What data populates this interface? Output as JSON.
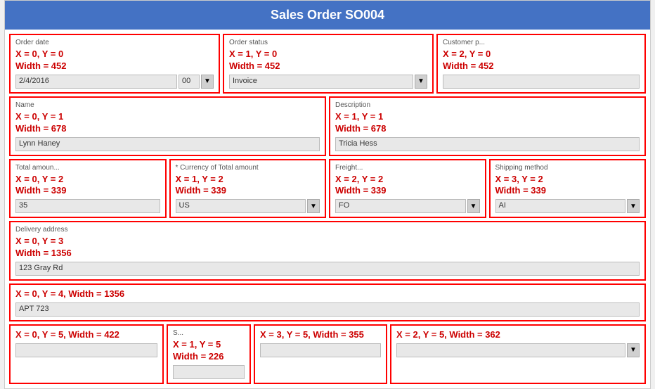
{
  "title": "Sales Order SO004",
  "rows": [
    {
      "id": "row0",
      "cells": [
        {
          "label": "Order date",
          "coord": "X = 0, Y = 0",
          "width": "Width = 452",
          "input_value": "2/4/2016",
          "input2_value": "00",
          "has_dropdown": true
        },
        {
          "label": "Order status",
          "coord": "X = 1, Y = 0",
          "width": "Width = 452",
          "input_value": "Invoice",
          "has_dropdown": true
        },
        {
          "label": "Customer p...",
          "coord": "X = 2, Y = 0",
          "width": "Width = 452",
          "input_value": "",
          "has_dropdown": false
        }
      ]
    },
    {
      "id": "row1",
      "cells": [
        {
          "label": "Name",
          "coord": "X = 0, Y = 1",
          "width": "Width = 678",
          "input_value": "Lynn Haney",
          "has_dropdown": false
        },
        {
          "label": "Description",
          "coord": "X = 1, Y = 1",
          "width": "Width = 678",
          "input_value": "Tricia Hess",
          "has_dropdown": false
        }
      ]
    },
    {
      "id": "row2",
      "cells": [
        {
          "label": "Total amoun...",
          "coord": "X = 0, Y = 2",
          "width": "Width = 339",
          "input_value": "35",
          "has_dropdown": false
        },
        {
          "label": "* Currency of Total amount",
          "coord": "X = 1, Y = 2",
          "width": "Width = 339",
          "input_value": "US",
          "has_dropdown": true
        },
        {
          "label": "Freight...",
          "coord": "X = 2, Y = 2",
          "width": "Width = 339",
          "input_value": "FO",
          "has_dropdown": true
        },
        {
          "label": "Shipping method",
          "coord": "X = 3, Y = 2",
          "width": "Width = 339",
          "input_value": "AI",
          "has_dropdown": true
        }
      ]
    },
    {
      "id": "row3",
      "cells": [
        {
          "label": "Delivery address",
          "coord": "X = 0, Y = 3",
          "width": "Width = 1356",
          "input_value": "123 Gray Rd",
          "has_dropdown": false
        }
      ]
    },
    {
      "id": "row4",
      "cells": [
        {
          "label": "",
          "coord": "X = 0, Y = 4, Width = 1356",
          "width": "",
          "input_value": "APT 723",
          "has_dropdown": false
        }
      ]
    },
    {
      "id": "row5",
      "cells": [
        {
          "label": "",
          "coord": "X = 0, Y = 5, Width = 422",
          "width": "",
          "input_value": "",
          "has_dropdown": false
        },
        {
          "label": "S...",
          "coord": "X = 1, Y = 5\nWidth = 226",
          "width": "",
          "input_value": "",
          "has_dropdown": false
        },
        {
          "label": "",
          "coord": "X = 3, Y = 5, Width = 355",
          "width": "",
          "input_value": "",
          "has_dropdown": false
        },
        {
          "label": "",
          "coord": "X = 2, Y = 5, Width = 362",
          "width": "",
          "input_value": "",
          "has_dropdown": true
        }
      ]
    }
  ]
}
